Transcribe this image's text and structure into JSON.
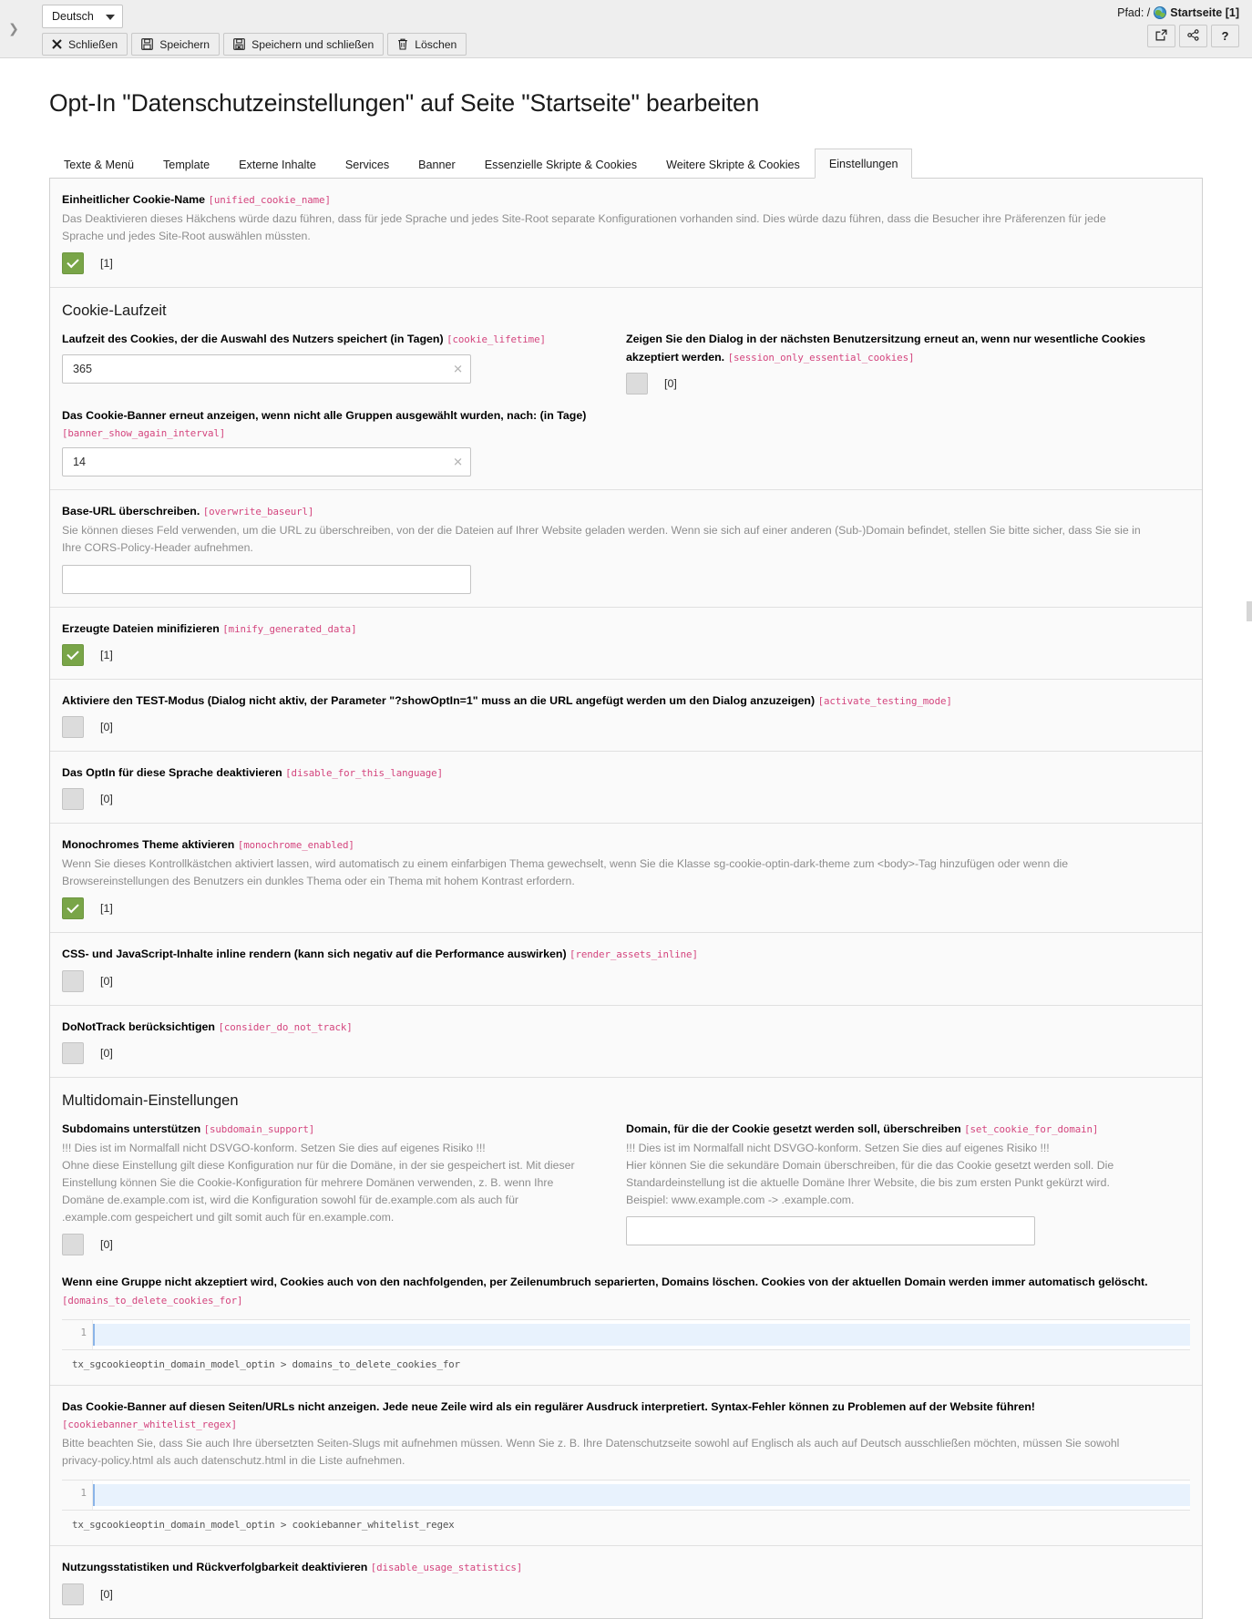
{
  "docheader": {
    "collapse_icon": "chevron-right-icon",
    "language_select": {
      "value": "Deutsch",
      "icon": "chevron-down-icon"
    },
    "buttons": [
      {
        "id": "close",
        "label": "Schließen",
        "icon": "close-x-icon"
      },
      {
        "id": "save",
        "label": "Speichern",
        "icon": "floppy-save-icon"
      },
      {
        "id": "save-close",
        "label": "Speichern und schließen",
        "icon": "floppy-save-close-icon"
      },
      {
        "id": "delete",
        "label": "Löschen",
        "icon": "trash-icon"
      }
    ],
    "path": {
      "prefix": "Pfad: /",
      "page_icon": "globe-page-icon",
      "page": "Startseite [1]"
    },
    "right_buttons": [
      {
        "id": "view-page",
        "label": "",
        "icon": "open-external-icon"
      },
      {
        "id": "share",
        "label": "",
        "icon": "share-nodes-icon"
      },
      {
        "id": "help",
        "label": "?",
        "icon": "question-mark-icon"
      }
    ]
  },
  "page_title": "Opt-In \"Datenschutzeinstellungen\" auf Seite \"Startseite\" bearbeiten",
  "tabs": [
    {
      "label": "Texte & Menü",
      "active": false
    },
    {
      "label": "Template",
      "active": false
    },
    {
      "label": "Externe Inhalte",
      "active": false
    },
    {
      "label": "Services",
      "active": false
    },
    {
      "label": "Banner",
      "active": false
    },
    {
      "label": "Essenzielle Skripte & Cookies",
      "active": false
    },
    {
      "label": "Weitere Skripte & Cookies",
      "active": false
    },
    {
      "label": "Einstellungen",
      "active": true
    }
  ],
  "fields": {
    "unified_cookie_name": {
      "label": "Einheitlicher Cookie-Name",
      "key": "[unified_cookie_name]",
      "description": "Das Deaktivieren dieses Häkchens würde dazu führen, dass für jede Sprache und jedes Site-Root separate Konfigurationen vorhanden sind. Dies würde dazu führen, dass die Besucher ihre Präferenzen für jede Sprache und jedes Site-Root auswählen müssten.",
      "checked": true,
      "value": "[1]"
    },
    "cookie_lifetime_group_title": "Cookie-Laufzeit",
    "cookie_lifetime": {
      "label": "Laufzeit des Cookies, der die Auswahl des Nutzers speichert (in Tagen)",
      "key": "[cookie_lifetime]",
      "value": "365",
      "clear_icon": "clear-x-icon"
    },
    "session_only_essential_cookies": {
      "label": "Zeigen Sie den Dialog in der nächsten Benutzersitzung erneut an, wenn nur wesentliche Cookies akzeptiert werden.",
      "key": "[session_only_essential_cookies]",
      "checked": false,
      "value": "[0]"
    },
    "banner_show_again_interval": {
      "label": "Das Cookie-Banner erneut anzeigen, wenn nicht alle Gruppen ausgewählt wurden, nach: (in Tage)",
      "key": "[banner_show_again_interval]",
      "value": "14",
      "clear_icon": "clear-x-icon"
    },
    "overwrite_baseurl": {
      "label": "Base-URL überschreiben.",
      "key": "[overwrite_baseurl]",
      "description": "Sie können dieses Feld verwenden, um die URL zu überschreiben, von der die Dateien auf Ihrer Website geladen werden. Wenn sie sich auf einer anderen (Sub-)Domain befindet, stellen Sie bitte sicher, dass Sie sie in Ihre CORS-Policy-Header aufnehmen.",
      "value": "",
      "placeholder": ""
    },
    "minify_generated_data": {
      "label": "Erzeugte Dateien minifizieren",
      "key": "[minify_generated_data]",
      "checked": true,
      "value": "[1]"
    },
    "activate_testing_mode": {
      "label": "Aktiviere den TEST-Modus (Dialog nicht aktiv, der Parameter \"?showOptIn=1\" muss an die URL angefügt werden um den Dialog anzuzeigen)",
      "key": "[activate_testing_mode]",
      "checked": false,
      "value": "[0]"
    },
    "disable_for_this_language": {
      "label": "Das OptIn für diese Sprache deaktivieren",
      "key": "[disable_for_this_language]",
      "checked": false,
      "value": "[0]"
    },
    "monochrome_enabled": {
      "label": "Monochromes Theme aktivieren",
      "key": "[monochrome_enabled]",
      "description": "Wenn Sie dieses Kontrollkästchen aktiviert lassen, wird automatisch zu einem einfarbigen Thema gewechselt, wenn Sie die Klasse sg-cookie-optin-dark-theme zum <body>-Tag hinzufügen oder wenn die Browsereinstellungen des Benutzers ein dunkles Thema oder ein Thema mit hohem Kontrast erfordern.",
      "checked": true,
      "value": "[1]"
    },
    "render_assets_inline": {
      "label": "CSS- und JavaScript-Inhalte inline rendern (kann sich negativ auf die Performance auswirken)",
      "key": "[render_assets_inline]",
      "checked": false,
      "value": "[0]"
    },
    "consider_do_not_track": {
      "label": "DoNotTrack berücksichtigen",
      "key": "[consider_do_not_track]",
      "checked": false,
      "value": "[0]"
    },
    "multidomain_group_title": "Multidomain-Einstellungen",
    "subdomain_support": {
      "label": "Subdomains unterstützen",
      "key": "[subdomain_support]",
      "description": "!!! Dies ist im Normalfall nicht DSVGO-konform. Setzen Sie dies auf eigenes Risiko !!!\nOhne diese Einstellung gilt diese Konfiguration nur für die Domäne, in der sie gespeichert ist. Mit dieser Einstellung können Sie die Cookie-Konfiguration für mehrere Domänen verwenden, z. B. wenn Ihre Domäne de.example.com ist, wird die Konfiguration sowohl für de.example.com als auch für .example.com gespeichert und gilt somit auch für en.example.com.",
      "checked": false,
      "value": "[0]"
    },
    "set_cookie_for_domain": {
      "label": "Domain, für die der Cookie gesetzt werden soll, überschreiben",
      "key": "[set_cookie_for_domain]",
      "description": "!!! Dies ist im Normalfall nicht DSVGO-konform. Setzen Sie dies auf eigenes Risiko !!!\nHier können Sie die sekundäre Domain überschreiben, für die das Cookie gesetzt werden soll. Die Standardeinstellung ist die aktuelle Domäne Ihrer Website, die bis zum ersten Punkt gekürzt wird. Beispiel: www.example.com -> .example.com.",
      "value": "",
      "placeholder": ""
    },
    "domains_to_delete_cookies_for": {
      "label": "Wenn eine Gruppe nicht akzeptiert wird, Cookies auch von den nachfolgenden, per Zeilenumbruch separierten, Domains löschen. Cookies von der aktuellen Domain werden immer automatisch gelöscht.",
      "key": "[domains_to_delete_cookies_for]",
      "line_number": "1",
      "content": "",
      "footer": "tx_sgcookieoptin_domain_model_optin > domains_to_delete_cookies_for"
    },
    "cookiebanner_whitelist_regex": {
      "label": "Das Cookie-Banner auf diesen Seiten/URLs nicht anzeigen. Jede neue Zeile wird als ein regulärer Ausdruck interpretiert. Syntax-Fehler können zu Problemen auf der Website führen!",
      "key": "[cookiebanner_whitelist_regex]",
      "description": "Bitte beachten Sie, dass Sie auch Ihre übersetzten Seiten-Slugs mit aufnehmen müssen. Wenn Sie z. B. Ihre Datenschutzseite sowohl auf Englisch als auch auf Deutsch ausschließen möchten, müssen Sie sowohl privacy-policy.html als auch datenschutz.html in die Liste aufnehmen.",
      "line_number": "1",
      "content": "",
      "footer": "tx_sgcookieoptin_domain_model_optin > cookiebanner_whitelist_regex"
    },
    "disable_usage_statistics": {
      "label": "Nutzungsstatistiken und Rückverfolgbarkeit deaktivieren",
      "key": "[disable_usage_statistics]",
      "checked": false,
      "value": "[0]"
    }
  },
  "colors": {
    "key_pink": "#d4457e",
    "checkbox_on_green": "#79a548",
    "muted_text": "#8d8d8d",
    "page_bg": "#ffffff",
    "pane_bg": "#fafafa"
  }
}
